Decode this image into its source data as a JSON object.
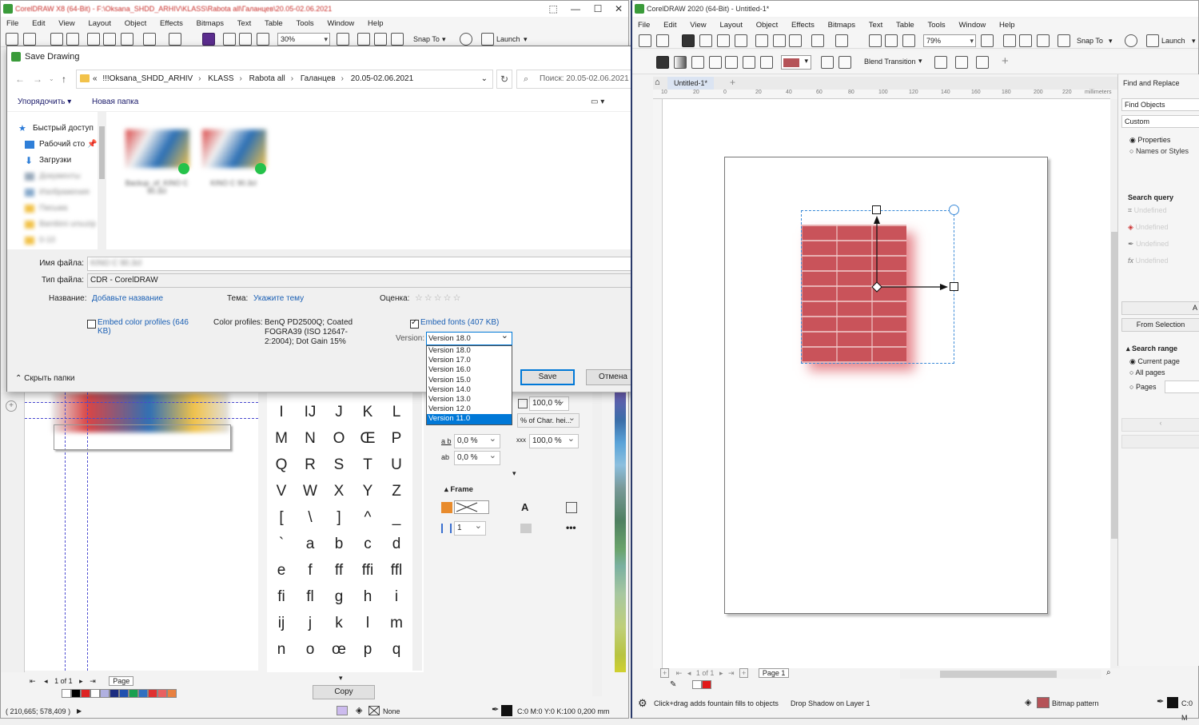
{
  "left_app": {
    "title": "CorelDRAW X8 (64-Bit) - F:\\Oksana_SHDD_ARHIV\\KLASS\\Rabota all\\Галанцев\\20.05-02.06.2021",
    "menu": [
      "File",
      "Edit",
      "View",
      "Layout",
      "Object",
      "Effects",
      "Bitmaps",
      "Text",
      "Table",
      "Tools",
      "Window",
      "Help"
    ],
    "zoom": "30%",
    "snap_to": "Snap To",
    "launch": "Launch",
    "page_nav": "1 of 1",
    "page_tab": "Page",
    "glyphs": [
      "I",
      "IJ",
      "J",
      "K",
      "L",
      "M",
      "N",
      "O",
      "Œ",
      "P",
      "Q",
      "R",
      "S",
      "T",
      "U",
      "V",
      "W",
      "X",
      "Y",
      "Z",
      "[",
      "\\",
      "]",
      "^",
      "_",
      "`",
      "a",
      "b",
      "c",
      "d",
      "e",
      "f",
      "ff",
      "ffi",
      "ffl",
      "fi",
      "fl",
      "g",
      "h",
      "i",
      "ij",
      "j",
      "k",
      "l",
      "m",
      "n",
      "o",
      "œ",
      "p",
      "q"
    ],
    "copy_button": "Copy",
    "props": {
      "val1": "100,0 %",
      "char_height": "% of Char. hei...",
      "val2": "0,0 %",
      "val3": "100,0 %",
      "val4": "0,0 %",
      "frame": "Frame",
      "columns": "1"
    },
    "status": {
      "coords": "( 210,665; 578,409 )",
      "fill": "None",
      "outline": "C:0 M:0 Y:0 K:100  0,200 mm"
    }
  },
  "dialog": {
    "title": "Save Drawing",
    "breadcrumb": [
      "«",
      "!!!Oksana_SHDD_ARHIV",
      "KLASS",
      "Rabota all",
      "Галанцев",
      "20.05-02.06.2021"
    ],
    "search_placeholder": "Поиск: 20.05-02.06.2021",
    "organize": "Упорядочить",
    "new_folder": "Новая папка",
    "nav": [
      {
        "label": "Быстрый доступ"
      },
      {
        "label": "Рабочий сто"
      },
      {
        "label": "Загрузки"
      },
      {
        "label": "Документы"
      },
      {
        "label": "Изображения"
      },
      {
        "label": "Письма"
      },
      {
        "label": "Bambini ursuzip"
      },
      {
        "label": "0-10"
      }
    ],
    "files": [
      {
        "name": "Backup_of_KINO C 90.3cl"
      },
      {
        "name": "KINO C 90.3cl"
      }
    ],
    "filename_label": "Имя файла:",
    "filename_value": "KINO C 90.3cl",
    "filetype_label": "Тип файла:",
    "filetype_value": "CDR - CorelDRAW",
    "name_label": "Название:",
    "name_link": "Добавьте название",
    "theme_label": "Тема:",
    "theme_link": "Укажите тему",
    "rating_label": "Оценка:",
    "rating": "☆☆☆☆☆",
    "embed_color": "Embed color profiles (646 KB)",
    "color_profiles_label": "Color profiles:",
    "color_profiles_value": "BenQ PD2500Q; Coated FOGRA39 (ISO 12647-2:2004); Dot Gain 15%",
    "embed_fonts": "Embed fonts (407 KB)",
    "version_label": "Version:",
    "version_selected": "Version 18.0",
    "versions": [
      "Version 18.0",
      "Version 17.0",
      "Version 16.0",
      "Version 15.0",
      "Version 14.0",
      "Version 13.0",
      "Version 12.0",
      "Version 11.0"
    ],
    "highlighted_version": "Version 11.0",
    "save": "Save",
    "cancel": "Отмена",
    "hide_folders": "Скрыть папки"
  },
  "right_app": {
    "title": "CorelDRAW 2020 (64-Bit) - Untitled-1*",
    "menu": [
      "File",
      "Edit",
      "View",
      "Layout",
      "Object",
      "Effects",
      "Bitmaps",
      "Text",
      "Table",
      "Tools",
      "Window",
      "Help"
    ],
    "zoom": "79%",
    "snap_to": "Snap To",
    "launch": "Launch",
    "blend": "Blend Transition",
    "doc_tab": "Untitled-1*",
    "ruler_unit": "millimeters",
    "ruler_ticks": [
      "10",
      "20",
      "0",
      "20",
      "40",
      "60",
      "80",
      "100",
      "120",
      "140",
      "160",
      "180",
      "200",
      "220"
    ],
    "page_nav": "1 of 1",
    "page_tab": "Page 1",
    "docker": {
      "title": "Find and Replace",
      "find_objects": "Find Objects",
      "custom": "Custom",
      "properties": "Properties",
      "names_styles": "Names or Styles",
      "search_query": "Search query",
      "queries": [
        "Undefined",
        "Undefined",
        "Undefined",
        "Undefined"
      ],
      "from_selection": "From Selection",
      "search_range": "Search range",
      "current_page": "Current page",
      "all_pages": "All pages",
      "pages": "Pages"
    },
    "status": {
      "hint": "Click+drag adds fountain fills to objects",
      "layer": "Drop Shadow on Layer 1",
      "fill": "Bitmap pattern",
      "outline": "C:0 M"
    }
  }
}
